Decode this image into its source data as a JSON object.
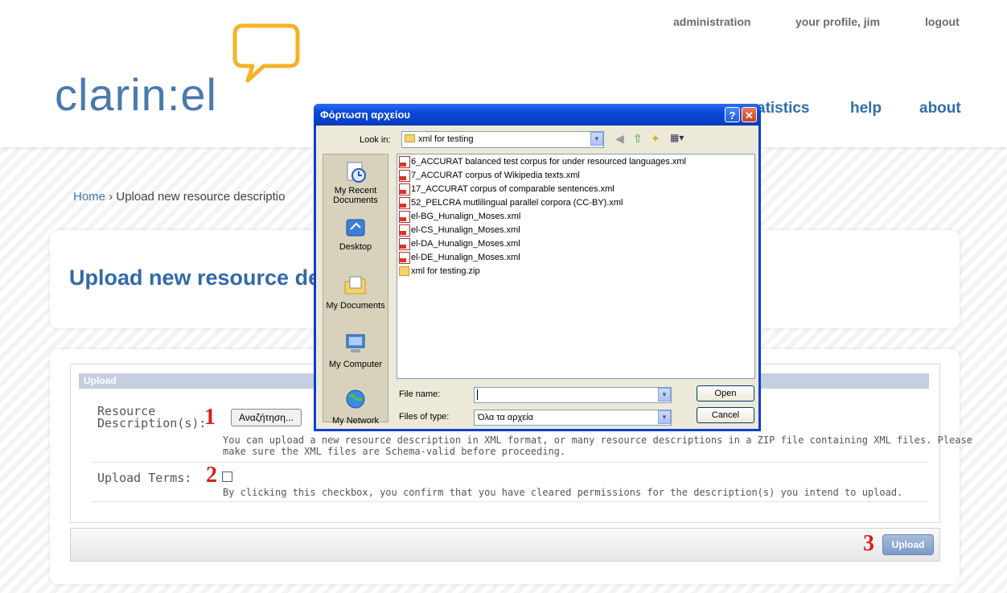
{
  "header": {
    "top_links": [
      "administration",
      "your profile, jim",
      "logout"
    ],
    "logo_text": "clarin:el",
    "nav_visible": [
      "atistics",
      "help",
      "about"
    ]
  },
  "breadcrumb": {
    "home": "Home",
    "separator": "›",
    "current": "Upload new resource descriptio"
  },
  "page": {
    "title": "Upload new resource de"
  },
  "form": {
    "section_header": "Upload",
    "resource_label_line1": "Resource",
    "resource_label_line2": "Description(s):",
    "browse_button": "Αναζήτηση...",
    "resource_help_line1": "You can upload a new resource description in XML format, or many resource descriptions in a ZIP file containing XML files. Please",
    "resource_help_line2": "make sure the XML files are Schema-valid before proceeding.",
    "terms_label": "Upload Terms:",
    "terms_help": "By clicking this checkbox, you confirm that you have cleared permissions for the description(s) you intend to upload.",
    "terms_checked": false,
    "upload_button": "Upload",
    "step_markers": [
      "1",
      "2",
      "3"
    ]
  },
  "dialog": {
    "title": "Φόρτωση αρχείου",
    "help_btn": "?",
    "close_btn": "✕",
    "look_in_label": "Look in:",
    "look_in_value": "xml for testing",
    "places": [
      "My Recent Documents",
      "Desktop",
      "My Documents",
      "My Computer",
      "My Network"
    ],
    "files": [
      {
        "name": "6_ACCURAT balanced test corpus for under resourced languages.xml",
        "type": "xml"
      },
      {
        "name": "7_ACCURAT corpus of Wikipedia texts.xml",
        "type": "xml"
      },
      {
        "name": "17_ACCURAT corpus of comparable sentences.xml",
        "type": "xml"
      },
      {
        "name": "52_PELCRA mutlilingual parallel corpora (CC-BY).xml",
        "type": "xml"
      },
      {
        "name": "el-BG_Hunalign_Moses.xml",
        "type": "xml"
      },
      {
        "name": "el-CS_Hunalign_Moses.xml",
        "type": "xml"
      },
      {
        "name": "el-DA_Hunalign_Moses.xml",
        "type": "xml"
      },
      {
        "name": "el-DE_Hunalign_Moses.xml",
        "type": "xml"
      },
      {
        "name": "xml for testing.zip",
        "type": "zip"
      }
    ],
    "file_name_label": "File name:",
    "file_name_value": "",
    "files_of_type_label": "Files of type:",
    "files_of_type_value": "Όλα τα αρχεία",
    "open_button": "Open",
    "cancel_button": "Cancel"
  },
  "colors": {
    "brand_blue": "#3369a8",
    "logo_orange": "#f5b324",
    "step_red": "#d81e1e",
    "xp_title_blue": "#0a48d8"
  }
}
